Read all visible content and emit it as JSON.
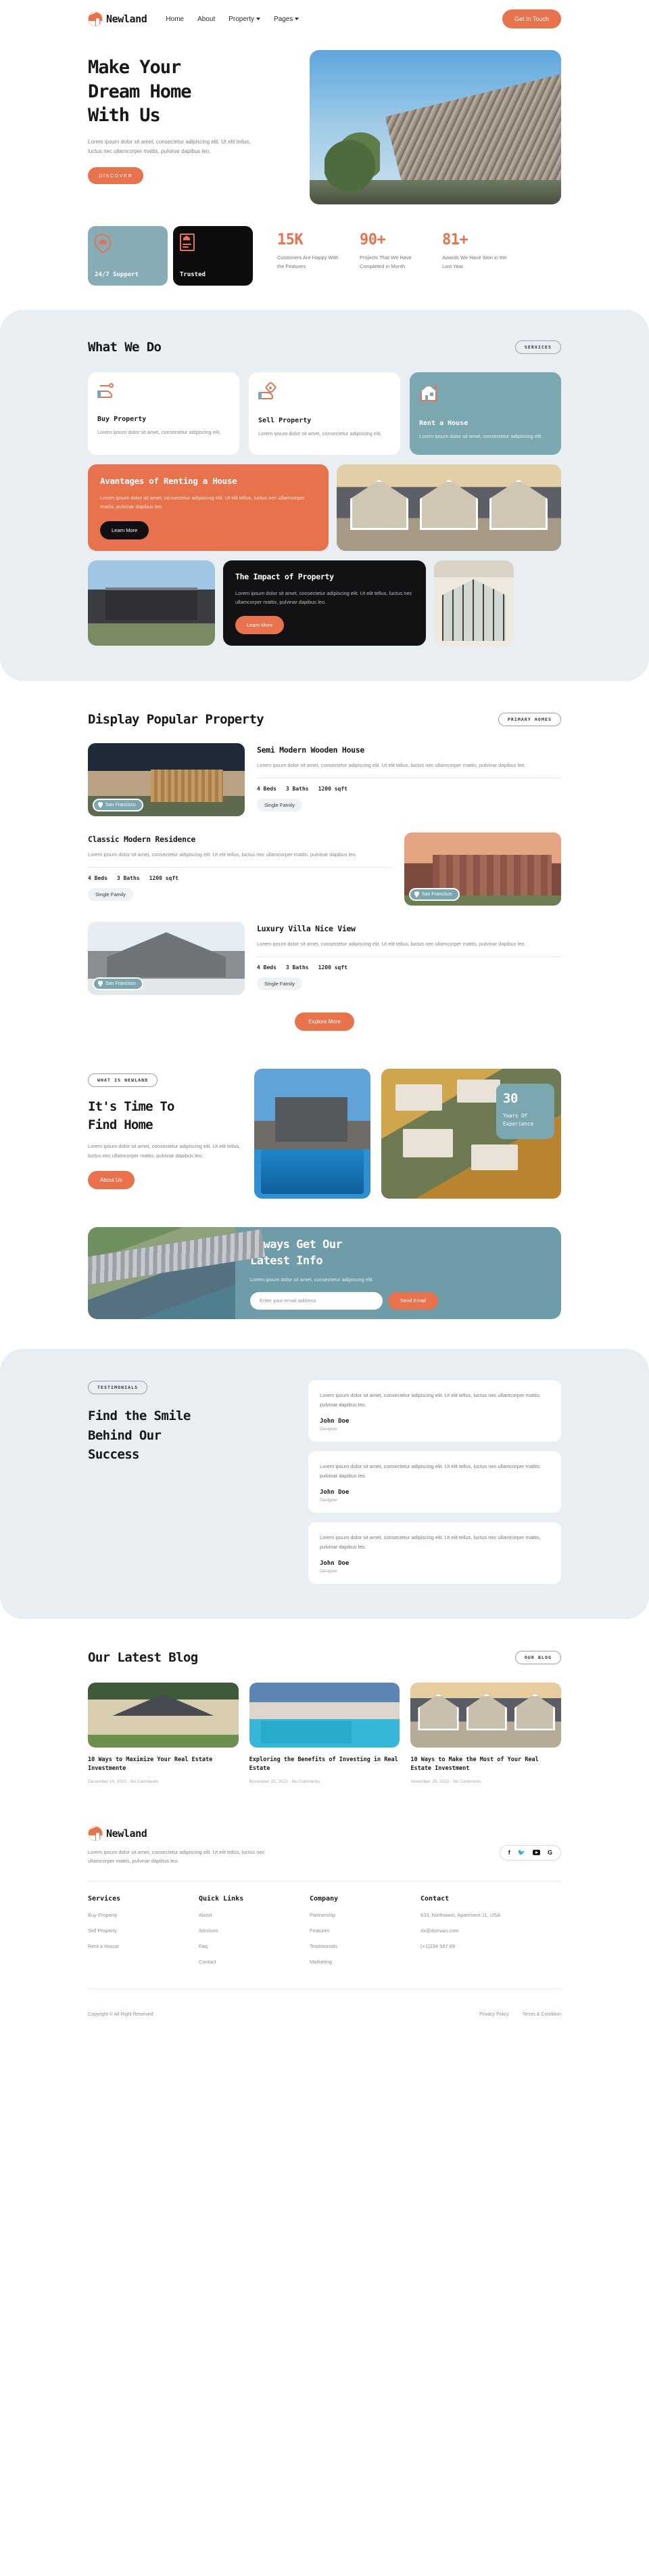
{
  "brand": {
    "name": "Newland"
  },
  "header": {
    "nav": [
      {
        "label": "Home",
        "caret": false
      },
      {
        "label": "About",
        "caret": false
      },
      {
        "label": "Property",
        "caret": true
      },
      {
        "label": "Pages",
        "caret": true
      }
    ],
    "cta": "Get In Touch"
  },
  "hero": {
    "title_line1": "Make Your",
    "title_line2": "Dream Home",
    "title_line3": "With Us",
    "subtitle": "Lorem ipsum dolor sit amet, consectetur adipiscing elit. Ut elit tellus, luctus nec ullamcorper mattis, pulvinar dapibus leo.",
    "button": "DISCOVER"
  },
  "feature_cards": [
    {
      "label": "24/7 Support",
      "icon": "home-pin-icon",
      "theme": "teal"
    },
    {
      "label": "Trusted",
      "icon": "document-sign-icon",
      "theme": "dark"
    }
  ],
  "stats": [
    {
      "number": "15K",
      "desc": "Customers Are Happy With the Features"
    },
    {
      "number": "90+",
      "desc": "Projects That We Have Completed in Month"
    },
    {
      "number": "81+",
      "desc": "Awards We Have Won in the Last Year"
    }
  ],
  "what_we_do": {
    "title": "What We Do",
    "tag": "SERVICES",
    "services": [
      {
        "icon": "key-hand-icon",
        "title": "Buy Property",
        "desc": "Lorem ipsum dolor sit amet, consectetur adipiscing elit."
      },
      {
        "icon": "tag-hand-icon",
        "title": "Sell Property",
        "desc": "Lorem ipsum dolor sit amet, consectetur adipiscing elit."
      },
      {
        "icon": "house-icon",
        "title": "Rent a House",
        "desc": "Lorem ipsum dolor sit amet, consectetur adipiscing elit."
      }
    ],
    "promo": {
      "title": "Avantages of Renting a House",
      "desc": "Lorem ipsum dolor sit amet, consectetur adipiscing elit. Ut elit tellus, luctus nec ullamcorper mattis, pulvinar dapibus leo.",
      "button": "Learn More"
    },
    "impact": {
      "title": "The Impact of Property",
      "desc": "Lorem ipsum dolor sit amet, consectetur adipiscing elit. Ut elit tellus, luctus nec ullamcorper mattis, pulvinar dapibus leo.",
      "button": "Learn More"
    }
  },
  "popular": {
    "title": "Display Popular Property",
    "tag": "PRIMARY HOMES",
    "explore_button": "Explore More",
    "items": [
      {
        "title": "Semi Modern Wooden House",
        "desc": "Lorem ipsum dolor sit amet, consectetur adipiscing elit. Ut elit tellus, luctus nec ullamcorper mattis, pulvinar dapibus leo.",
        "beds": "4 Beds",
        "baths": "3 Baths",
        "area": "1200 sqft",
        "chip": "Single Family",
        "location": "San Francisco"
      },
      {
        "title": "Classic Modern Residence",
        "desc": "Lorem ipsum dolor sit amet, consectetur adipiscing elit. Ut elit tellus, luctus nec ullamcorper mattis, pulvinar dapibus leo.",
        "beds": "4 Beds",
        "baths": "3 Baths",
        "area": "1200 sqft",
        "chip": "Single Family",
        "location": "San Francisco"
      },
      {
        "title": "Luxury Villa Nice View",
        "desc": "Lorem ipsum dolor sit amet, consectetur adipiscing elit. Ut elit tellus, luctus nec ullamcorper mattis, pulvinar dapibus leo.",
        "beds": "4 Beds",
        "baths": "3 Baths",
        "area": "1200 sqft",
        "chip": "Single Family",
        "location": "San Francisco"
      }
    ]
  },
  "find_home": {
    "tag": "WHAT IS NEWLAND",
    "title_line1": "It's Time To",
    "title_line2": "Find Home",
    "desc": "Lorem ipsum dolor sit amet, consectetur adipiscing elit. Ut elit tellus, luctus nec ullamcorper mattis, pulvinar dapibus leo.",
    "button": "About Us",
    "years_number": "30",
    "years_label_line1": "Years Of",
    "years_label_line2": "Experience"
  },
  "newsletter": {
    "title_line1": "Always Get Our",
    "title_line2": "Latest Info",
    "desc": "Lorem ipsum dolor sit amet, consectetur adipiscing elit.",
    "placeholder": "Enter your email address",
    "button": "Send Email"
  },
  "testimonials": {
    "tag": "TESTIMONIALS",
    "title_line1": "Find the Smile",
    "title_line2": "Behind Our",
    "title_line3": "Success",
    "items": [
      {
        "quote": "Lorem ipsum dolor sit amet, consectetur adipiscing elit. Ut elit tellus, luctus nec ullamcorper mattis, pulvinar dapibus leo.",
        "name": "John Doe",
        "role": "Designer"
      },
      {
        "quote": "Lorem ipsum dolor sit amet, consectetur adipiscing elit. Ut elit tellus, luctus nec ullamcorper mattis, pulvinar dapibus leo.",
        "name": "John Doe",
        "role": "Designer"
      },
      {
        "quote": "Lorem ipsum dolor sit amet, consectetur adipiscing elit. Ut elit tellus, luctus nec ullamcorper mattis, pulvinar dapibus leo.",
        "name": "John Doe",
        "role": "Designer"
      }
    ]
  },
  "blog": {
    "title": "Our Latest Blog",
    "tag": "OUR BLOG",
    "posts": [
      {
        "title": "10 Ways to Maximize Your Real Estate Investmente",
        "meta": "December 14, 2022 - No Comments"
      },
      {
        "title": "Exploring the Benefits of Investing in Real Estate",
        "meta": "November 25, 2022 - No Comments"
      },
      {
        "title": "10 Ways to Make the Most of Your Real Estate Investment",
        "meta": "November 25, 2022 - No Comments"
      }
    ]
  },
  "footer": {
    "desc": "Lorem ipsum dolor sit amet, consectetur adipiscing elit. Ut elit tellus, luctus nec ullamcorper mattis, pulvinar dapibus leo.",
    "socials": [
      {
        "name": "facebook-icon",
        "glyph": "f"
      },
      {
        "name": "twitter-icon",
        "glyph": "✉"
      },
      {
        "name": "youtube-icon",
        "glyph": ""
      },
      {
        "name": "google-icon",
        "glyph": "G"
      }
    ],
    "columns": [
      {
        "heading": "Services",
        "links": [
          "Buy Property",
          "Sell Property",
          "Rent a House"
        ]
      },
      {
        "heading": "Quick Links",
        "links": [
          "About",
          "Services",
          "Faq",
          "Contact"
        ]
      },
      {
        "heading": "Company",
        "links": [
          "Partnership",
          "Features",
          "Testimonials",
          "Marketing"
        ]
      }
    ],
    "contact": {
      "heading": "Contact",
      "address": "633, Northwest, Apartment 11, USA",
      "email": "ex@domain.com",
      "phone": "(+1)234 567 89"
    },
    "copyright": "Copyright © All Right Reserved",
    "bottom_links": [
      "Privacy Policy",
      "Terms & Condition"
    ]
  },
  "colors": {
    "accent": "#e8724c",
    "teal": "#7ba7b1",
    "dark": "#121214",
    "section_bg": "#e8eef2"
  }
}
